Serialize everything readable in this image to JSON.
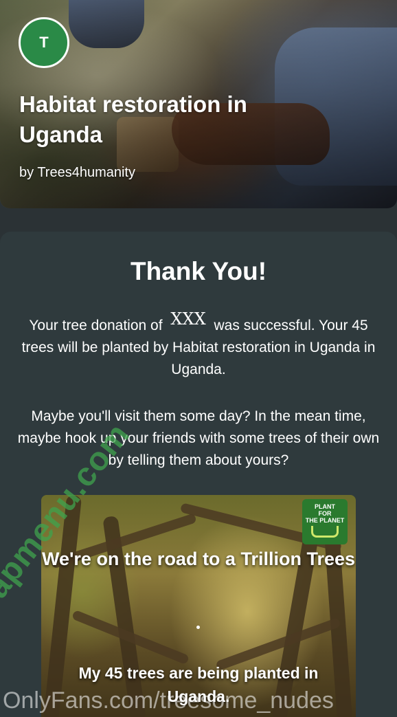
{
  "header": {
    "avatar_letter": "T",
    "title": "Habitat restoration in Uganda",
    "byline": "by Trees4humanity"
  },
  "card": {
    "heading": "Thank You!",
    "message_prefix": "Your tree donation of",
    "amount": "XXX",
    "message_suffix": "was successful. Your 45 trees will be planted by Habitat restoration in Uganda in Uganda.",
    "invite": "Maybe you'll visit them some day? In the mean time, maybe hook up your friends with some trees of their own by telling them about yours?"
  },
  "share_image": {
    "logo_lines": [
      "PLANT",
      "FOR",
      "THE PLANET"
    ],
    "headline": "We're on the road to a Trillion Trees",
    "subline": "My 45 trees are being planted in Uganda."
  },
  "watermarks": {
    "side": "fapmenu.com",
    "bottom": "OnlyFans.com/treesome_nudes"
  },
  "colors": {
    "background": "#2b3235",
    "card": "#2f3a3d",
    "avatar": "#2a8a47",
    "watermark_green": "#3fa34d"
  }
}
